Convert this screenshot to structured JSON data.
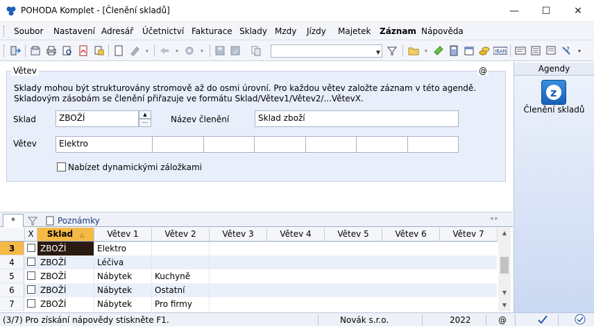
{
  "window": {
    "title": "POHODA Komplet - [Členění skladů]"
  },
  "menu": [
    "Soubor",
    "Nastavení",
    "Adresář",
    "Účetnictví",
    "Fakturace",
    "Sklady",
    "Mzdy",
    "Jízdy",
    "Majetek",
    "Záznam",
    "Nápověda"
  ],
  "toolbar": {
    "search_value": ""
  },
  "form": {
    "legend": "Větev",
    "at": "@",
    "description_line1": "Sklady mohou být strukturovány stromově až do osmi úrovní. Pro každou větev založte záznam v této agendě.",
    "description_line2": "Skladovým zásobám se členění přiřazuje ve formátu Sklad/Větev1/Větev2/...VětevX.",
    "sklad_label": "Sklad",
    "sklad_value": "ZBOŽÍ",
    "sklad_btn": "...",
    "nazev_label": "Název členění",
    "nazev_value": "Sklad zboží",
    "vetev_label": "Větev",
    "vetev_values": [
      "Elektro",
      "",
      "",
      "",
      "",
      "",
      ""
    ],
    "checkbox_label": "Nabízet dynamickými záložkami"
  },
  "sidebar": {
    "header": "Agendy",
    "item_label": "Členění skladů"
  },
  "tabs": {
    "star": "*",
    "notes": "Poznámky",
    "nav": "◂ ▸"
  },
  "grid": {
    "columns": [
      "X",
      "Sklad",
      "Větev 1",
      "Větev 2",
      "Větev 3",
      "Větev 4",
      "Větev 5",
      "Větev 6",
      "Větev 7"
    ],
    "rows": [
      {
        "num": "3",
        "sklad": "ZBOŽÍ",
        "v1": "Elektro",
        "v2": "",
        "current": true
      },
      {
        "num": "4",
        "sklad": "ZBOŽÍ",
        "v1": "Léčiva",
        "v2": ""
      },
      {
        "num": "5",
        "sklad": "ZBOŽÍ",
        "v1": "Nábytek",
        "v2": "Kuchyně"
      },
      {
        "num": "6",
        "sklad": "ZBOŽÍ",
        "v1": "Nábytek",
        "v2": "Ostatní"
      },
      {
        "num": "7",
        "sklad": "ZBOŽÍ",
        "v1": "Nábytek",
        "v2": "Pro firmy"
      }
    ]
  },
  "status": {
    "record": "(3/7) Pro získání nápovědy stiskněte F1.",
    "company": "Novák s.r.o.",
    "year": "2022",
    "at": "@"
  },
  "colors": {
    "accent": "#f5b945",
    "selected_cell": "#2b1a10",
    "form_bg": "#e8eefa"
  }
}
